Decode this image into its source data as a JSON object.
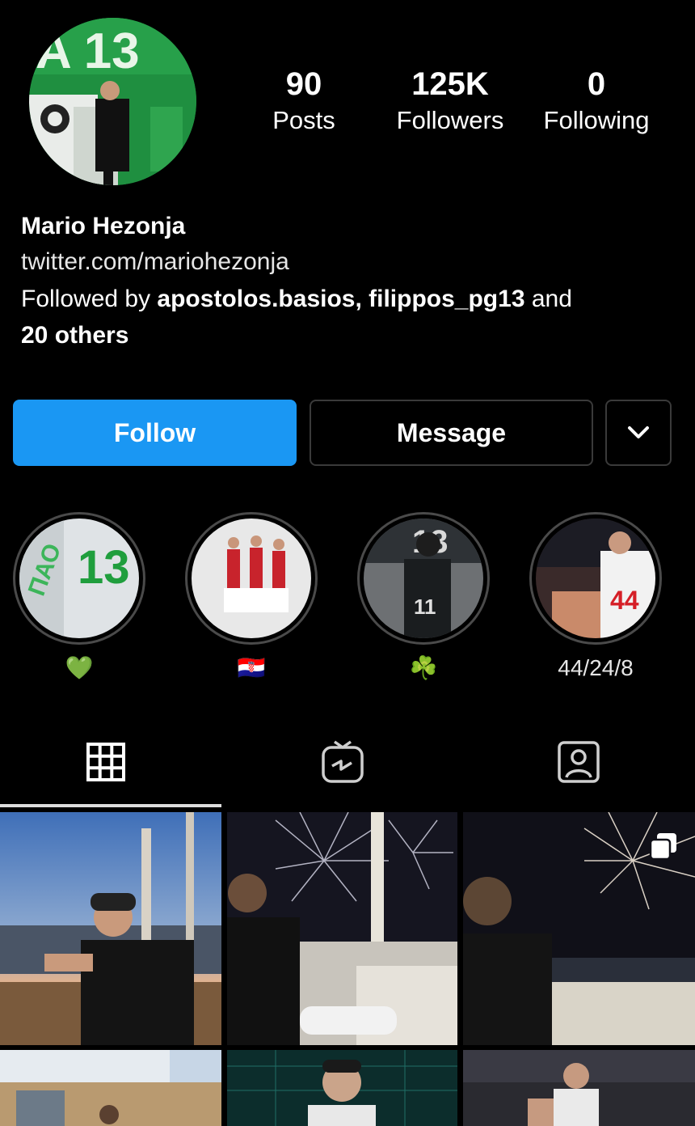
{
  "profile": {
    "name": "Mario Hezonja",
    "link": "twitter.com/mariohezonja",
    "followed_by_prefix": "Followed by ",
    "followed_by_users": "apostolos.basios, filippos_pg13",
    "followed_by_and": " and",
    "followed_by_others": "20 others"
  },
  "stats": [
    {
      "value": "90",
      "label": "Posts"
    },
    {
      "value": "125K",
      "label": "Followers"
    },
    {
      "value": "0",
      "label": "Following"
    }
  ],
  "actions": {
    "follow_label": "Follow",
    "message_label": "Message",
    "more_icon": "chevron-down-icon"
  },
  "highlights": [
    {
      "label": "💚"
    },
    {
      "label": "🇭🇷"
    },
    {
      "label": "☘️"
    },
    {
      "label": "44/24/8"
    }
  ],
  "tabs": [
    {
      "icon": "grid-icon",
      "active": true
    },
    {
      "icon": "igtv-icon",
      "active": false
    },
    {
      "icon": "tagged-icon",
      "active": false
    }
  ],
  "colors": {
    "accent": "#1a97f3",
    "background": "#000000",
    "border": "#3a3a3a"
  }
}
